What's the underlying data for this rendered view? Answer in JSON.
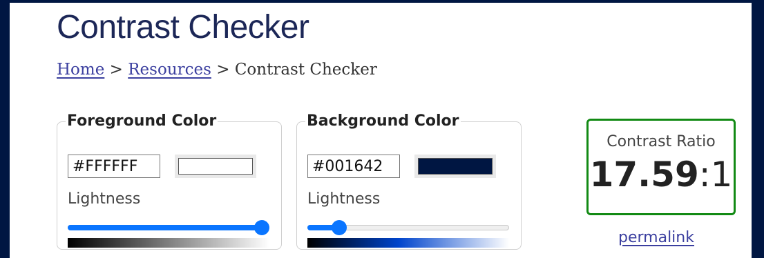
{
  "page": {
    "title": "Contrast Checker"
  },
  "breadcrumb": {
    "items": [
      "Home",
      "Resources",
      "Contrast Checker"
    ],
    "separator": ">"
  },
  "foreground": {
    "legend": "Foreground Color",
    "hex_value": "#FFFFFF",
    "swatch_color": "#FFFFFF",
    "lightness_label": "Lightness",
    "lightness_fraction": 1.0
  },
  "background": {
    "legend": "Background Color",
    "hex_value": "#001642",
    "swatch_color": "#001642",
    "lightness_label": "Lightness",
    "lightness_fraction": 0.13
  },
  "result": {
    "label": "Contrast Ratio",
    "ratio": "17.59",
    "suffix": ":1",
    "border_color": "#128a14"
  },
  "permalink_label": "permalink",
  "colors": {
    "frame": "#001642",
    "accent": "#0a75ff",
    "link": "#3b3f9f"
  }
}
